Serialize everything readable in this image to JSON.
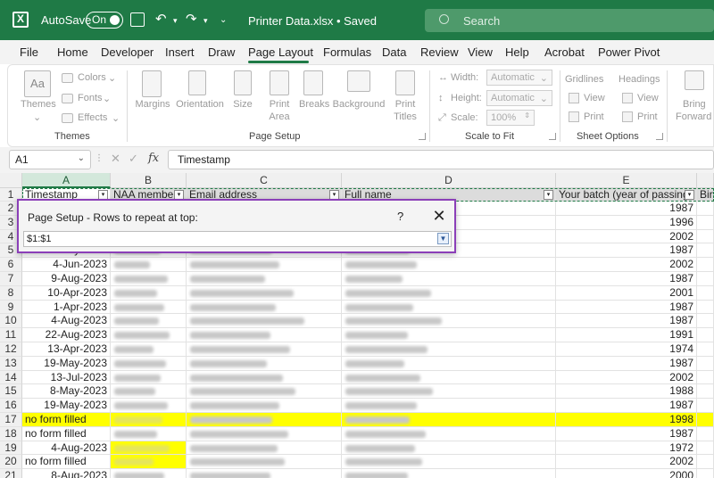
{
  "titlebar": {
    "autosave_label": "AutoSave",
    "autosave_state": "On",
    "document_title": "Printer Data.xlsx • Saved",
    "search_placeholder": "Search"
  },
  "menu": [
    "File",
    "Home",
    "Developer",
    "Insert",
    "Draw",
    "Page Layout",
    "Formulas",
    "Data",
    "Review",
    "View",
    "Help",
    "Acrobat",
    "Power Pivot"
  ],
  "active_menu": "Page Layout",
  "ribbon": {
    "themes": {
      "themes_btn": "Themes",
      "colors": "Colors",
      "fonts": "Fonts",
      "effects": "Effects",
      "label": "Themes"
    },
    "page_setup": {
      "margins": "Margins",
      "orientation": "Orientation",
      "size": "Size",
      "print_area_1": "Print",
      "print_area_2": "Area",
      "breaks": "Breaks",
      "background": "Background",
      "print_titles_1": "Print",
      "print_titles_2": "Titles",
      "label": "Page Setup"
    },
    "scale": {
      "width": "Width:",
      "width_val": "Automatic",
      "height": "Height:",
      "height_val": "Automatic",
      "scale": "Scale:",
      "scale_val": "100%",
      "label": "Scale to Fit"
    },
    "sheet_options": {
      "gridlines": "Gridlines",
      "headings": "Headings",
      "view": "View",
      "print": "Print",
      "label": "Sheet Options"
    },
    "arrange": {
      "bring_1": "Bring",
      "bring_2": "Forward"
    }
  },
  "formula_bar": {
    "name_box": "A1",
    "fx": "fx",
    "content": "Timestamp"
  },
  "columns": [
    "A",
    "B",
    "C",
    "D",
    "E"
  ],
  "header_row": [
    "Timestamp",
    "NAA membe",
    "Email address",
    "Full name",
    "Your batch (year of passing",
    "Birt"
  ],
  "rows": [
    {
      "n": "2",
      "a": "",
      "e": "1987",
      "hl": false
    },
    {
      "n": "3",
      "a": "",
      "e": "1996",
      "hl": false
    },
    {
      "n": "4",
      "a": "",
      "e": "2002",
      "hl": false
    },
    {
      "n": "5",
      "a": "19-May-2023",
      "e": "1987",
      "hl": false
    },
    {
      "n": "6",
      "a": "4-Jun-2023",
      "e": "2002",
      "hl": false
    },
    {
      "n": "7",
      "a": "9-Aug-2023",
      "e": "1987",
      "hl": false
    },
    {
      "n": "8",
      "a": "10-Apr-2023",
      "e": "2001",
      "hl": false
    },
    {
      "n": "9",
      "a": "1-Apr-2023",
      "e": "1987",
      "hl": false
    },
    {
      "n": "10",
      "a": "4-Aug-2023",
      "e": "1987",
      "hl": false
    },
    {
      "n": "11",
      "a": "22-Aug-2023",
      "e": "1991",
      "hl": false
    },
    {
      "n": "12",
      "a": "13-Apr-2023",
      "e": "1974",
      "hl": false
    },
    {
      "n": "13",
      "a": "19-May-2023",
      "e": "1987",
      "hl": false
    },
    {
      "n": "14",
      "a": "13-Jul-2023",
      "e": "2002",
      "hl": false
    },
    {
      "n": "15",
      "a": "8-May-2023",
      "e": "1988",
      "hl": false
    },
    {
      "n": "16",
      "a": "19-May-2023",
      "e": "1987",
      "hl": false
    },
    {
      "n": "17",
      "a": "no form filled",
      "e": "1998",
      "hl": true
    },
    {
      "n": "18",
      "a": "no form filled",
      "e": "1987",
      "hl": false
    },
    {
      "n": "19",
      "a": "4-Aug-2023",
      "e": "1972",
      "hl": false
    },
    {
      "n": "20",
      "a": "no form filled",
      "e": "2002",
      "hl": false
    },
    {
      "n": "21",
      "a": "8-Aug-2023",
      "e": "2000",
      "hl": false
    }
  ],
  "dialog": {
    "title": "Page Setup - Rows to repeat at top:",
    "help": "?",
    "close": "✕",
    "value": "$1:$1"
  },
  "colors": {
    "brand": "#1f7a46",
    "highlight": "#ffff00",
    "dialog_border": "#8b3fb8"
  }
}
